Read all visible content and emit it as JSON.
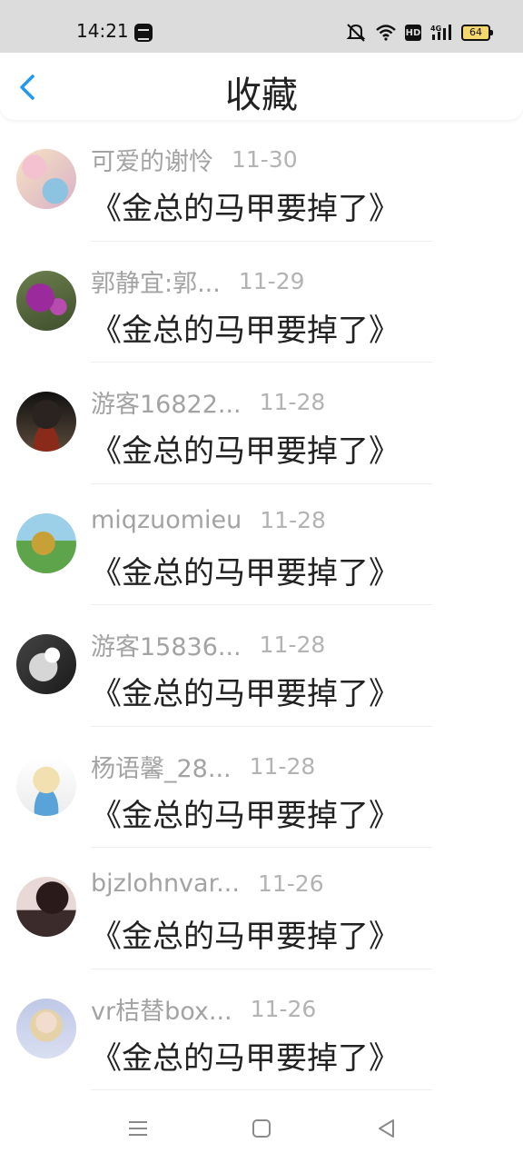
{
  "status_bar": {
    "time": "14:21",
    "hd_label": "HD",
    "network_label": "4G",
    "battery": "64"
  },
  "header": {
    "title": "收藏"
  },
  "favorites": [
    {
      "user": "可爱的谢怜",
      "date": "11-30",
      "title": "《金总的马甲要掉了》"
    },
    {
      "user": "郭静宜:郭...",
      "date": "11-29",
      "title": "《金总的马甲要掉了》"
    },
    {
      "user": "游客16822...",
      "date": "11-28",
      "title": "《金总的马甲要掉了》"
    },
    {
      "user": "miqzuomieu",
      "date": "11-28",
      "title": "《金总的马甲要掉了》"
    },
    {
      "user": "游客15836...",
      "date": "11-28",
      "title": "《金总的马甲要掉了》"
    },
    {
      "user": "杨语馨_28...",
      "date": "11-28",
      "title": "《金总的马甲要掉了》"
    },
    {
      "user": "bjzlohnvar...",
      "date": "11-26",
      "title": "《金总的马甲要掉了》"
    },
    {
      "user": "vr桔替box...",
      "date": "11-26",
      "title": "《金总的马甲要掉了》"
    }
  ],
  "colors": {
    "accent": "#2196f3",
    "status_bar": "#dcdcdc",
    "muted_text": "#a3a3a3"
  },
  "icons": [
    "back-icon",
    "mute-icon",
    "wifi-icon",
    "signal-icon",
    "battery-icon",
    "menu-icon",
    "home-icon",
    "back-triangle-icon"
  ]
}
